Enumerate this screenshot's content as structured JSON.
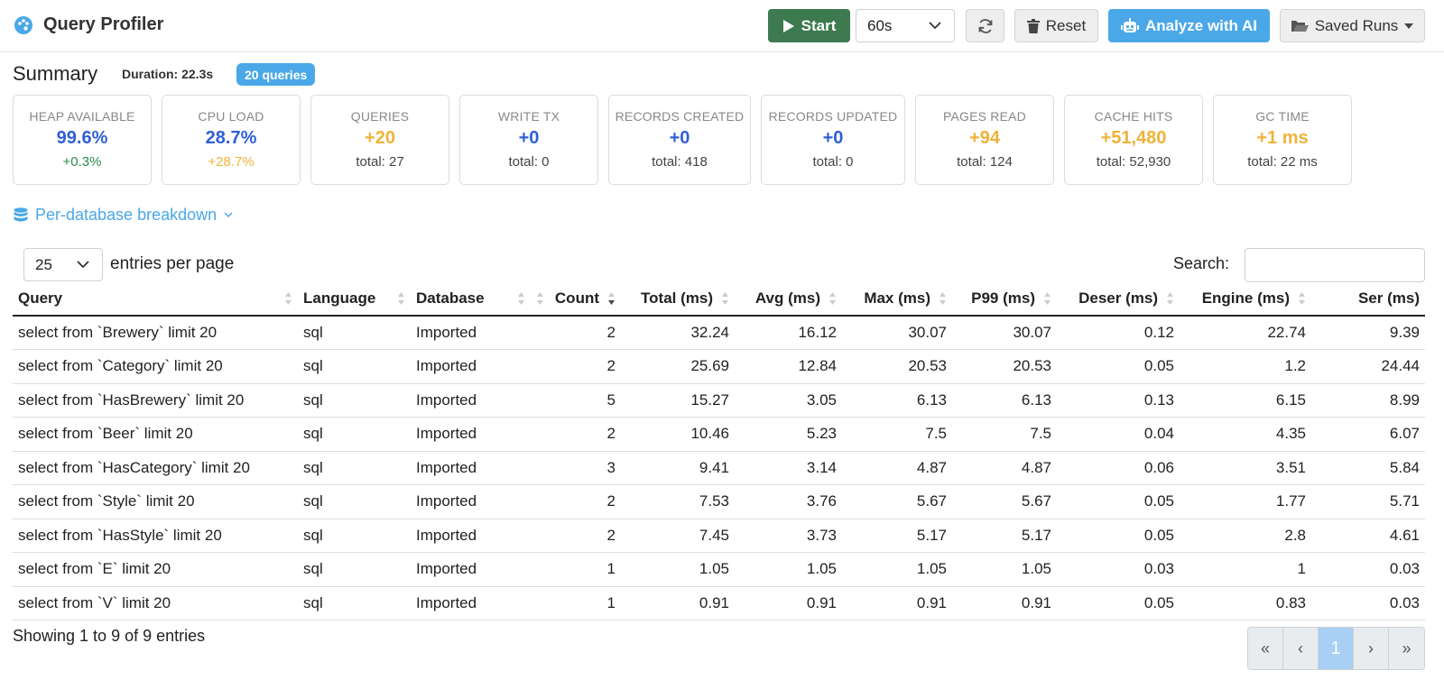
{
  "app": {
    "title": "Query Profiler"
  },
  "toolbar": {
    "start_label": "Start",
    "duration_value": "60s",
    "reset_label": "Reset",
    "ai_label": "Analyze with AI",
    "saved_label": "Saved Runs"
  },
  "summary": {
    "title": "Summary",
    "duration": "Duration: 22.3s",
    "queries_badge": "20 queries",
    "cards": [
      {
        "label": "HEAP AVAILABLE",
        "value": "99.6%",
        "sub": "+0.3%",
        "value_color": "#2f5fd6",
        "sub_color": "#2f8a4a"
      },
      {
        "label": "CPU LOAD",
        "value": "28.7%",
        "sub": "+28.7%",
        "value_color": "#2f5fd6",
        "sub_color": "#f0b23a"
      },
      {
        "label": "QUERIES",
        "value": "+20",
        "sub": "total: 27",
        "value_color": "#f0b23a",
        "sub_color": "#444444"
      },
      {
        "label": "WRITE TX",
        "value": "+0",
        "sub": "total: 0",
        "value_color": "#2f5fd6",
        "sub_color": "#444444"
      },
      {
        "label": "RECORDS CREATED",
        "value": "+0",
        "sub": "total: 418",
        "value_color": "#2f5fd6",
        "sub_color": "#444444"
      },
      {
        "label": "RECORDS UPDATED",
        "value": "+0",
        "sub": "total: 0",
        "value_color": "#2f5fd6",
        "sub_color": "#444444"
      },
      {
        "label": "PAGES READ",
        "value": "+94",
        "sub": "total: 124",
        "value_color": "#f0b23a",
        "sub_color": "#444444"
      },
      {
        "label": "CACHE HITS",
        "value": "+51,480",
        "sub": "total: 52,930",
        "value_color": "#f0b23a",
        "sub_color": "#444444"
      },
      {
        "label": "GC TIME",
        "value": "+1 ms",
        "sub": "total: 22 ms",
        "value_color": "#f0b23a",
        "sub_color": "#444444"
      }
    ]
  },
  "breakdown": {
    "label": "Per-database breakdown"
  },
  "entries": {
    "value": "25",
    "label": "entries per page"
  },
  "search": {
    "label": "Search:",
    "value": ""
  },
  "table": {
    "columns": [
      "Query",
      "Language",
      "Database",
      "Count",
      "Total (ms)",
      "Avg (ms)",
      "Max (ms)",
      "P99 (ms)",
      "Deser (ms)",
      "Engine (ms)",
      "Ser (ms)"
    ],
    "rows": [
      [
        "select from `Brewery` limit 20",
        "sql",
        "Imported",
        "2",
        "32.24",
        "16.12",
        "30.07",
        "30.07",
        "0.12",
        "22.74",
        "9.39"
      ],
      [
        "select from `Category` limit 20",
        "sql",
        "Imported",
        "2",
        "25.69",
        "12.84",
        "20.53",
        "20.53",
        "0.05",
        "1.2",
        "24.44"
      ],
      [
        "select from `HasBrewery` limit 20",
        "sql",
        "Imported",
        "5",
        "15.27",
        "3.05",
        "6.13",
        "6.13",
        "0.13",
        "6.15",
        "8.99"
      ],
      [
        "select from `Beer` limit 20",
        "sql",
        "Imported",
        "2",
        "10.46",
        "5.23",
        "7.5",
        "7.5",
        "0.04",
        "4.35",
        "6.07"
      ],
      [
        "select from `HasCategory` limit 20",
        "sql",
        "Imported",
        "3",
        "9.41",
        "3.14",
        "4.87",
        "4.87",
        "0.06",
        "3.51",
        "5.84"
      ],
      [
        "select from `Style` limit 20",
        "sql",
        "Imported",
        "2",
        "7.53",
        "3.76",
        "5.67",
        "5.67",
        "0.05",
        "1.77",
        "5.71"
      ],
      [
        "select from `HasStyle` limit 20",
        "sql",
        "Imported",
        "2",
        "7.45",
        "3.73",
        "5.17",
        "5.17",
        "0.05",
        "2.8",
        "4.61"
      ],
      [
        "select from `E` limit 20",
        "sql",
        "Imported",
        "1",
        "1.05",
        "1.05",
        "1.05",
        "1.05",
        "0.03",
        "1",
        "0.03"
      ],
      [
        "select from `V` limit 20",
        "sql",
        "Imported",
        "1",
        "0.91",
        "0.91",
        "0.91",
        "0.91",
        "0.05",
        "0.83",
        "0.03"
      ]
    ]
  },
  "footer": {
    "info": "Showing 1 to 9 of 9 entries",
    "pager": [
      "«",
      "‹",
      "1",
      "›",
      "»"
    ]
  }
}
